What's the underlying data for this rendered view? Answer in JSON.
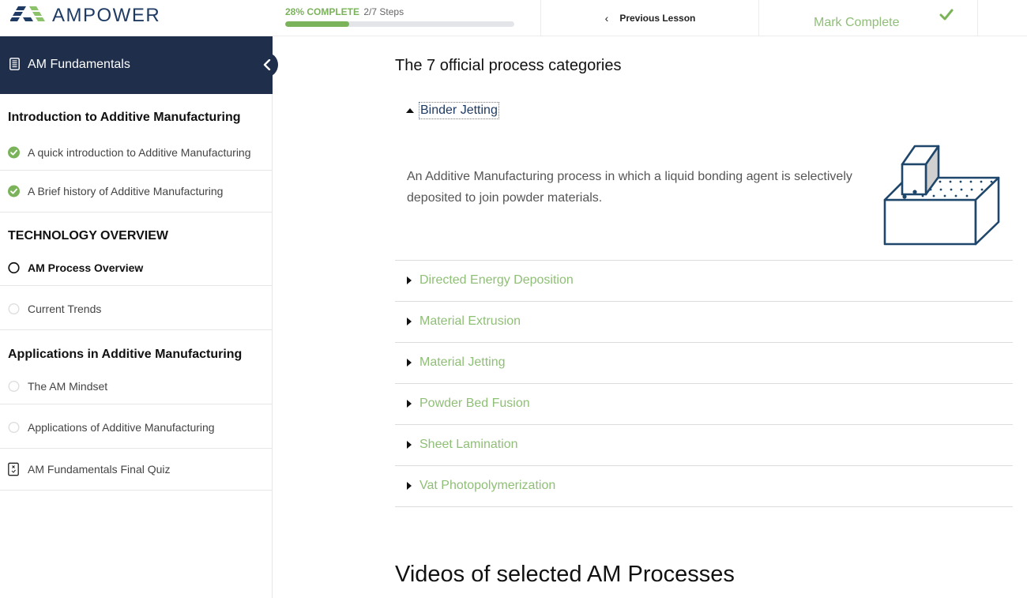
{
  "header": {
    "brand": "AMPOWER",
    "progress": {
      "percent_label": "28% COMPLETE",
      "steps_label": "2/7 Steps",
      "fraction": 0.28
    },
    "previous_lesson_label": "Previous Lesson",
    "mark_complete_label": "Mark Complete"
  },
  "sidebar": {
    "course_title": "AM Fundamentals",
    "sections": [
      {
        "title": "Introduction to Additive Manufacturing",
        "lessons": [
          {
            "label": "A quick introduction to Additive Manufacturing",
            "status": "complete"
          },
          {
            "label": "A Brief history of Additive Manufacturing",
            "status": "complete"
          }
        ]
      },
      {
        "title": "TECHNOLOGY OVERVIEW",
        "lessons": [
          {
            "label": "AM Process Overview",
            "status": "current"
          },
          {
            "label": "Current Trends",
            "status": "incomplete"
          }
        ]
      },
      {
        "title": "Applications in Additive Manufacturing",
        "lessons": [
          {
            "label": "The AM Mindset",
            "status": "incomplete"
          },
          {
            "label": "Applications of Additive Manufacturing",
            "status": "incomplete"
          },
          {
            "label": "AM Fundamentals Final Quiz",
            "status": "quiz"
          }
        ]
      }
    ]
  },
  "main": {
    "heading": "The 7 official process categories",
    "accordion": {
      "open": {
        "label": "Binder Jetting",
        "description": "An Additive Manufacturing process in which a liquid bonding agent is selectively deposited to join powder materials.",
        "illustration": "binder-jetting-illustration"
      },
      "closed": [
        "Directed Energy Deposition",
        "Material Extrusion",
        "Material Jetting",
        "Powder Bed Fusion",
        "Sheet Lamination",
        "Vat Photopolymerization"
      ]
    },
    "videos_heading": "Videos of selected AM Processes"
  },
  "colors": {
    "brand_navy": "#1f2e4b",
    "accent_green": "#7ab35a",
    "link_green": "#8fbf76"
  }
}
